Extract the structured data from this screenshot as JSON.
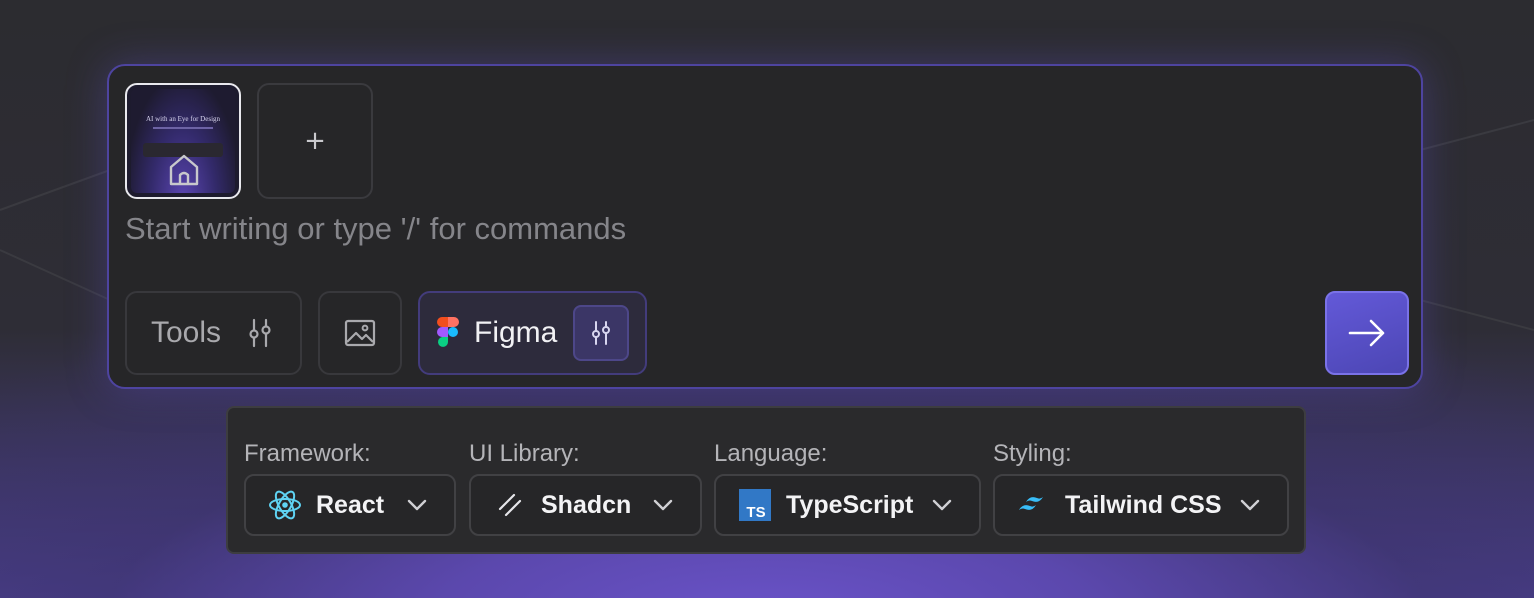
{
  "prompt": {
    "placeholder": "Start writing or type '/' for commands",
    "attachment_thumb_title": "AI with an Eye for Design",
    "add_label": "+"
  },
  "toolbar": {
    "tools_label": "Tools",
    "figma_label": "Figma"
  },
  "settings": {
    "framework": {
      "label": "Framework:",
      "value": "React",
      "icon": "react-icon"
    },
    "ui_library": {
      "label": "UI Library:",
      "value": "Shadcn",
      "icon": "shadcn-icon"
    },
    "language": {
      "label": "Language:",
      "value": "TypeScript",
      "icon": "typescript-icon",
      "icon_text": "TS"
    },
    "styling": {
      "label": "Styling:",
      "value": "Tailwind CSS",
      "icon": "tailwind-icon"
    }
  },
  "colors": {
    "accent": "#5b52d0",
    "card_border": "#4e44a0",
    "react": "#5fd3f3",
    "typescript": "#3178c6",
    "tailwind": "#38bdf8"
  }
}
